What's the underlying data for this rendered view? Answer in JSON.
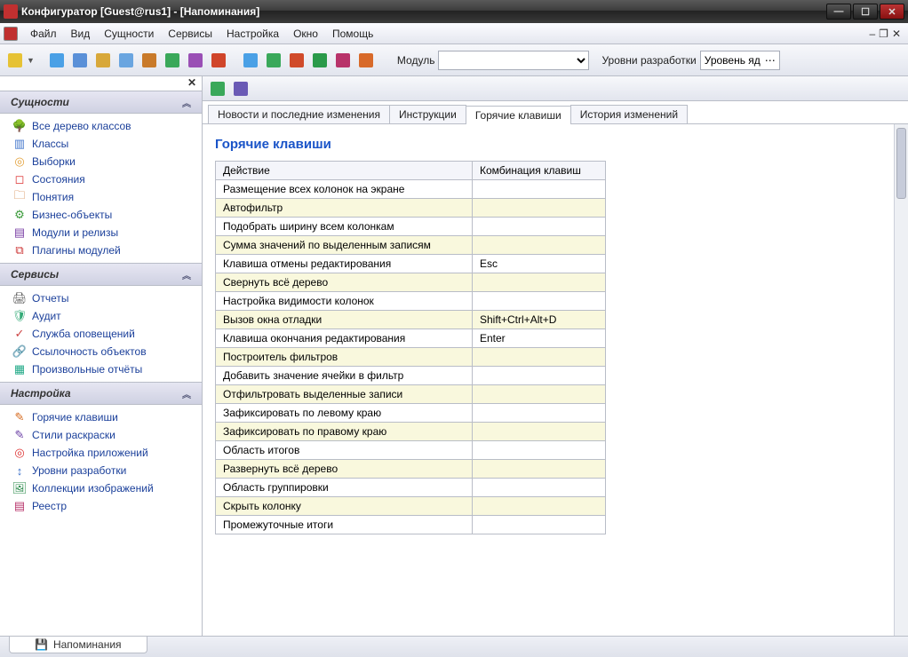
{
  "window": {
    "title": "Конфигуратор [Guest@rus1] - [Напоминания]"
  },
  "menu": [
    "Файл",
    "Вид",
    "Сущности",
    "Сервисы",
    "Настройка",
    "Окно",
    "Помощь"
  ],
  "toolbar": {
    "module_label": "Модуль",
    "dev_levels_label": "Уровни разработки",
    "dev_level_value": "Уровень яд"
  },
  "sidebar": {
    "groups": [
      {
        "title": "Сущности",
        "items": [
          {
            "icon": "🌳",
            "color": "#2a7",
            "label": "Все дерево классов"
          },
          {
            "icon": "▥",
            "color": "#47c",
            "label": "Классы"
          },
          {
            "icon": "◎",
            "color": "#e3a13a",
            "label": "Выборки"
          },
          {
            "icon": "◻",
            "color": "#d33",
            "label": "Состояния"
          },
          {
            "icon": "🗀",
            "color": "#c96a1f",
            "label": "Понятия"
          },
          {
            "icon": "⚙",
            "color": "#3a9a3a",
            "label": "Бизнес-объекты"
          },
          {
            "icon": "▤",
            "color": "#7a3fa5",
            "label": "Модули и релизы"
          },
          {
            "icon": "⧉",
            "color": "#c33",
            "label": "Плагины модулей"
          }
        ]
      },
      {
        "title": "Сервисы",
        "items": [
          {
            "icon": "🖨",
            "color": "#555",
            "label": "Отчеты"
          },
          {
            "icon": "🛡",
            "color": "#3a7",
            "label": "Аудит"
          },
          {
            "icon": "✓",
            "color": "#c44",
            "label": "Служба оповещений"
          },
          {
            "icon": "🔗",
            "color": "#c9a020",
            "label": "Ссылочность объектов"
          },
          {
            "icon": "▦",
            "color": "#2a8",
            "label": "Произвольные отчёты"
          }
        ]
      },
      {
        "title": "Настройка",
        "items": [
          {
            "icon": "✎",
            "color": "#d66a1f",
            "label": "Горячие клавиши"
          },
          {
            "icon": "✎",
            "color": "#6a3fa5",
            "label": "Стили раскраски"
          },
          {
            "icon": "◎",
            "color": "#d33",
            "label": "Настройка приложений"
          },
          {
            "icon": "↕",
            "color": "#3a6fc8",
            "label": "Уровни разработки"
          },
          {
            "icon": "🖼",
            "color": "#2a8a4a",
            "label": "Коллекции изображений"
          },
          {
            "icon": "▤",
            "color": "#b8336a",
            "label": "Реестр"
          }
        ]
      }
    ]
  },
  "tabs": [
    "Новости и последние изменения",
    "Инструкции",
    "Горячие клавиши",
    "История изменений"
  ],
  "active_tab": 2,
  "content": {
    "heading": "Горячие клавиши",
    "columns": [
      "Действие",
      "Комбинация клавиш"
    ],
    "rows": [
      {
        "action": "Размещение всех колонок на экране",
        "key": ""
      },
      {
        "action": "Автофильтр",
        "key": ""
      },
      {
        "action": "Подобрать ширину всем колонкам",
        "key": ""
      },
      {
        "action": "Сумма значений по выделенным записям",
        "key": ""
      },
      {
        "action": "Клавиша отмены редактирования",
        "key": "Esc"
      },
      {
        "action": "Свернуть всё дерево",
        "key": ""
      },
      {
        "action": "Настройка видимости колонок",
        "key": ""
      },
      {
        "action": "Вызов окна отладки",
        "key": "Shift+Ctrl+Alt+D"
      },
      {
        "action": "Клавиша окончания редактирования",
        "key": "Enter"
      },
      {
        "action": "Построитель фильтров",
        "key": ""
      },
      {
        "action": "Добавить значение ячейки в фильтр",
        "key": ""
      },
      {
        "action": "Отфильтровать выделенные записи",
        "key": ""
      },
      {
        "action": "Зафиксировать по левому краю",
        "key": ""
      },
      {
        "action": "Зафиксировать по правому краю",
        "key": ""
      },
      {
        "action": "Область итогов",
        "key": ""
      },
      {
        "action": "Развернуть всё дерево",
        "key": ""
      },
      {
        "action": "Область группировки",
        "key": ""
      },
      {
        "action": "Скрыть колонку",
        "key": ""
      },
      {
        "action": "Промежуточные итоги",
        "key": ""
      }
    ]
  },
  "doc_tab": {
    "icon": "💾",
    "label": "Напоминания"
  }
}
